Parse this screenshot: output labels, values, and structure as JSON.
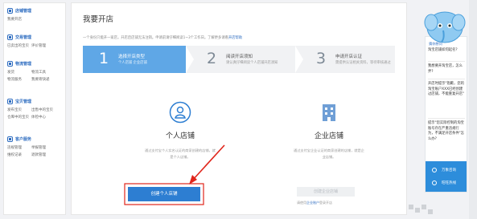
{
  "sidebar": {
    "sections": [
      {
        "title": "店铺管理",
        "rows": [
          [
            "我要开店",
            ""
          ]
        ]
      },
      {
        "title": "交易管理",
        "rows": [
          [
            "已卖出的宝贝",
            "评价管理"
          ]
        ]
      },
      {
        "title": "物流管理",
        "rows": [
          [
            "发货",
            "物流工具"
          ],
          [
            "物流服务",
            "我要寄快递"
          ]
        ]
      },
      {
        "title": "宝贝管理",
        "rows": [
          [
            "发布宝贝",
            "出售中的宝贝"
          ],
          [
            "仓库中的宝贝",
            "体检中心"
          ]
        ]
      },
      {
        "title": "客户服务",
        "rows": [
          [
            "违规管理",
            "举报管理"
          ],
          [
            "维权记录",
            "退款管理"
          ]
        ]
      }
    ]
  },
  "main": {
    "title": "我要开店",
    "hint": "一个身份只能开一家店，开店后店铺无法注销。申请前请仔细阅读1~3个工作日。了解更多请看",
    "hint_link": "开店帮助",
    "steps": [
      {
        "num": "1",
        "title": "选择开店类型",
        "desc": "个人店铺 企业店铺"
      },
      {
        "num": "2",
        "title": "阅读开店须知",
        "desc": "请认真仔细阅读个人店铺开店须知"
      },
      {
        "num": "3",
        "title": "申请开店认证",
        "desc": "需提供认证相关资料，等待审核通过"
      }
    ],
    "personal": {
      "title": "个人店铺",
      "desc": "通过支付宝个人实名认证的商家创建的店铺，就是个人店铺。",
      "button": "创建个人店铺"
    },
    "enterprise": {
      "title": "企业店铺",
      "desc": "通过支付宝企业认证的商家创建的店铺，就是企业店铺。",
      "button": "创建企业店铺",
      "note": "请使用",
      "note_link": "企业账户",
      "note_tail": "登录开店"
    }
  },
  "assistant": {
    "header": "猜你想问",
    "questions": [
      "淘宝店铺如何起名?",
      "我想要开淘宝店，怎么弄?",
      "开店时提示\"抱歉，您的淘宝账户XXX已经创建过店铺，不能重复开店\"",
      "提示\"您实际控制的淘宝账号存在严重违规行为，不满足开店条件\"怎么办?"
    ],
    "footer": [
      "万象咨询",
      "旺旺热线"
    ]
  },
  "colors": {
    "accent": "#2d7ed2",
    "step_active": "#5fa7e6",
    "arrow": "#e0261c"
  }
}
